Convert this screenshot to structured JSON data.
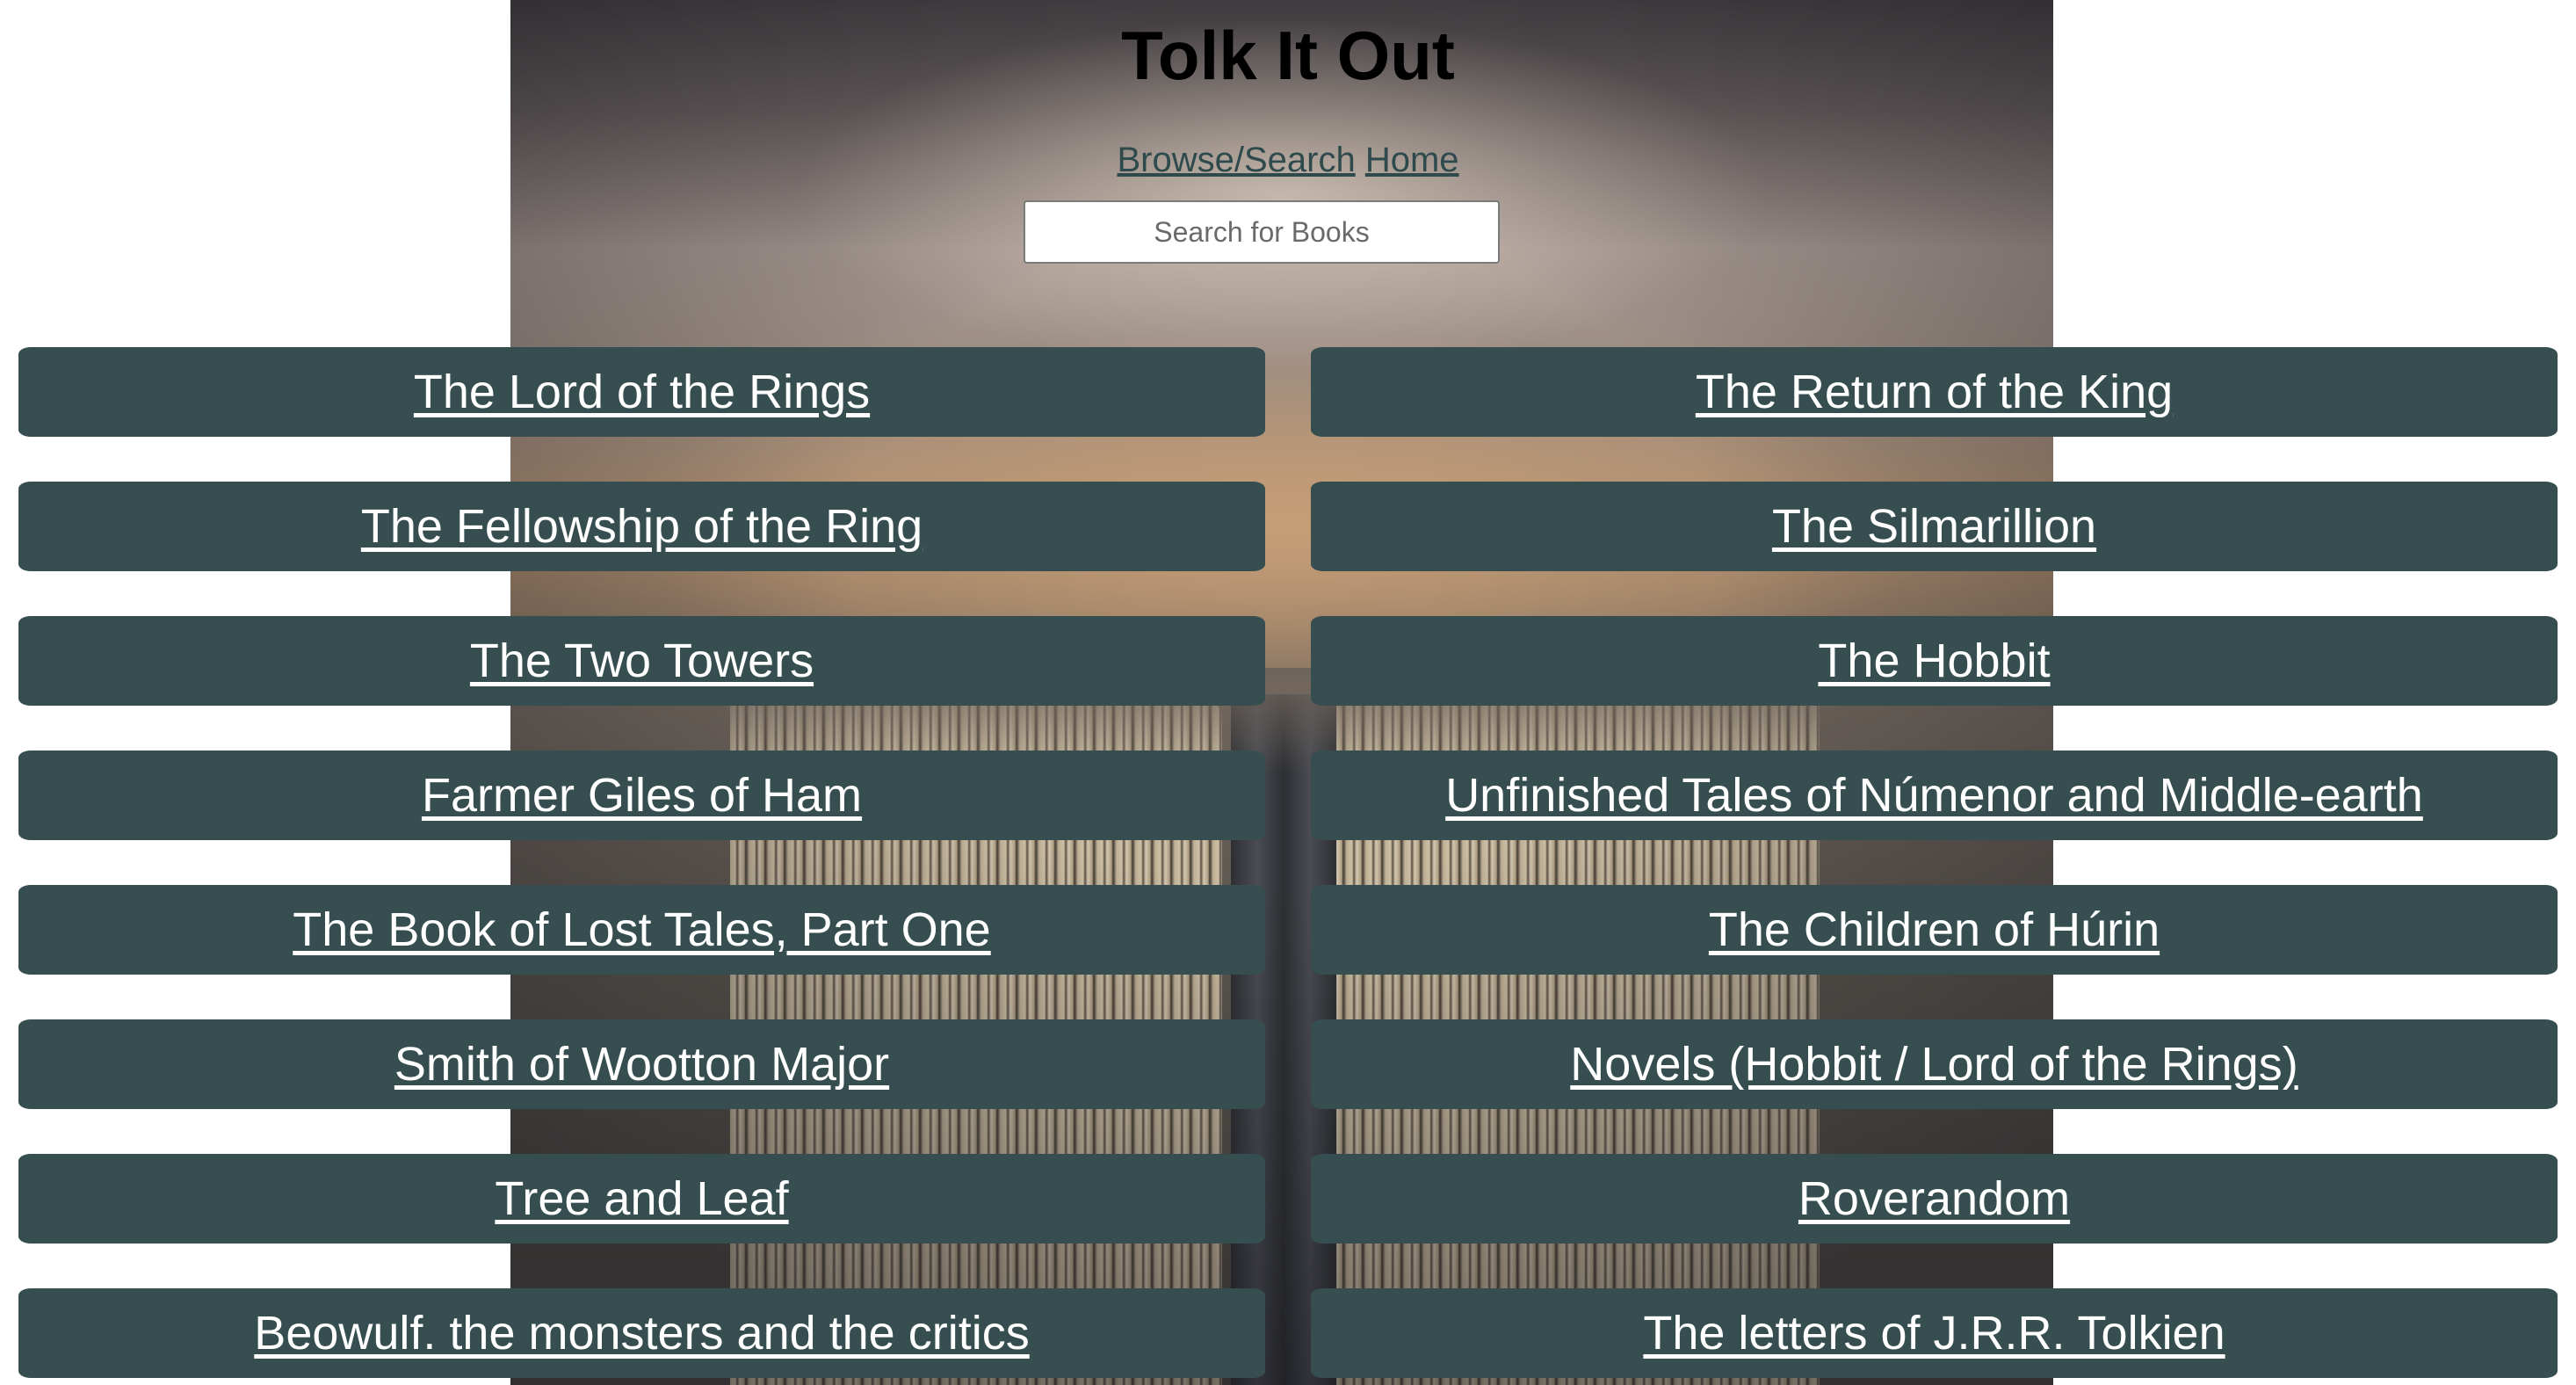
{
  "header": {
    "title": "Tolk It Out"
  },
  "nav": {
    "browse_label": "Browse/Search",
    "home_label": "Home"
  },
  "search": {
    "placeholder": "Search for Books",
    "value": ""
  },
  "books": [
    "The Lord of the Rings",
    "The Return of the King",
    "The Fellowship of the Ring",
    "The Silmarillion",
    "The Two Towers",
    "The Hobbit",
    "Farmer Giles of Ham",
    "Unfinished Tales of Númenor and Middle-earth",
    "The Book of Lost Tales, Part One",
    "The Children of Húrin",
    "Smith of Wootton Major",
    "Novels (Hobbit / Lord of the Rings)",
    "Tree and Leaf",
    "Roverandom",
    "Beowulf. the monsters and the critics",
    "The letters of J.R.R. Tolkien"
  ],
  "colors": {
    "button_bg": "#374e50",
    "button_text": "#ffffff",
    "nav_link": "#2f4a4c"
  }
}
